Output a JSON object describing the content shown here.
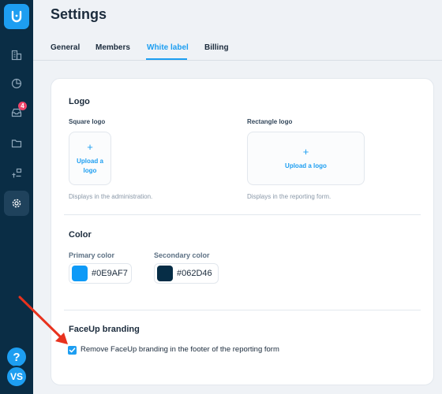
{
  "sidebar": {
    "badge_count": "4",
    "help_label": "?",
    "user_initials": "VS",
    "items": [
      {
        "icon": "building-icon"
      },
      {
        "icon": "pie-chart-icon"
      },
      {
        "icon": "inbox-icon"
      },
      {
        "icon": "folder-icon"
      },
      {
        "icon": "hierarchy-icon"
      },
      {
        "icon": "gear-icon",
        "active": true
      }
    ]
  },
  "page": {
    "title": "Settings"
  },
  "tabs": [
    {
      "label": "General"
    },
    {
      "label": "Members"
    },
    {
      "label": "White label",
      "active": true
    },
    {
      "label": "Billing"
    }
  ],
  "logo_section": {
    "title": "Logo",
    "square": {
      "label": "Square logo",
      "upload_text": "Upload a logo",
      "hint": "Displays in the administration."
    },
    "rectangle": {
      "label": "Rectangle logo",
      "upload_text": "Upload a logo",
      "hint": "Displays in the reporting form."
    }
  },
  "color_section": {
    "title": "Color",
    "primary": {
      "label": "Primary color",
      "value": "#0E9AF7"
    },
    "secondary": {
      "label": "Secondary color",
      "value": "#062D46"
    }
  },
  "branding_section": {
    "title": "FaceUp branding",
    "checkbox_label": "Remove FaceUp branding in the footer of the reporting form",
    "checked": true
  },
  "colors": {
    "accent": "#1D9EF1",
    "sidebar": "#0A2D45",
    "annotation_arrow": "#E8321E"
  }
}
